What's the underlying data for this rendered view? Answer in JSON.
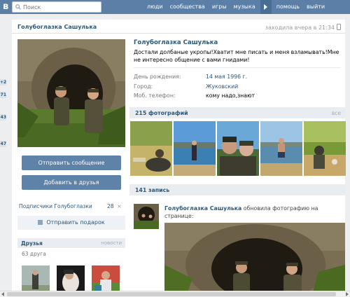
{
  "header": {
    "logo": "в",
    "search_placeholder": "Поиск",
    "nav": [
      "люди",
      "сообщества",
      "игры",
      "музыка",
      "помощь",
      "выйти"
    ]
  },
  "left_counters": [
    "+2",
    "71",
    "43",
    "47"
  ],
  "profile": {
    "page_title": "Голубоглазка Сашулька",
    "last_seen": "заходила вчера в 21:34",
    "name": "Голубоглазка Сашулька",
    "status": "Достали долбаные укропы!Хватит мне писать и меня взламывать!Мне не интересно общение с вами гнидами!",
    "info": [
      {
        "label": "День рождения:",
        "value": "14 мая 1996 г."
      },
      {
        "label": "Город:",
        "value": "Жуковский"
      },
      {
        "label": "Моб. телефон:",
        "value": "кому надо,знают"
      }
    ]
  },
  "actions": {
    "send_message": "Отправить сообщение",
    "add_friend": "Добавить в друзья",
    "subscribers_label": "Подписчики Голубоглазки",
    "subscribers_count": "28",
    "subscribers_close": "×",
    "send_gift": "Отправить подарок"
  },
  "friends": {
    "title": "Друзья",
    "news": "новости",
    "count": "63 друга"
  },
  "photos": {
    "title": "215 фотографий",
    "all": "все"
  },
  "wall": {
    "title": "141 запись",
    "author": "Голубоглазка Сашулька",
    "action": "обновила фотографию на странице:"
  },
  "colors": {
    "header": "#5b7fa6",
    "link": "#2b587a",
    "button": "#5e82a8",
    "section_bar": "#e9edf1"
  }
}
